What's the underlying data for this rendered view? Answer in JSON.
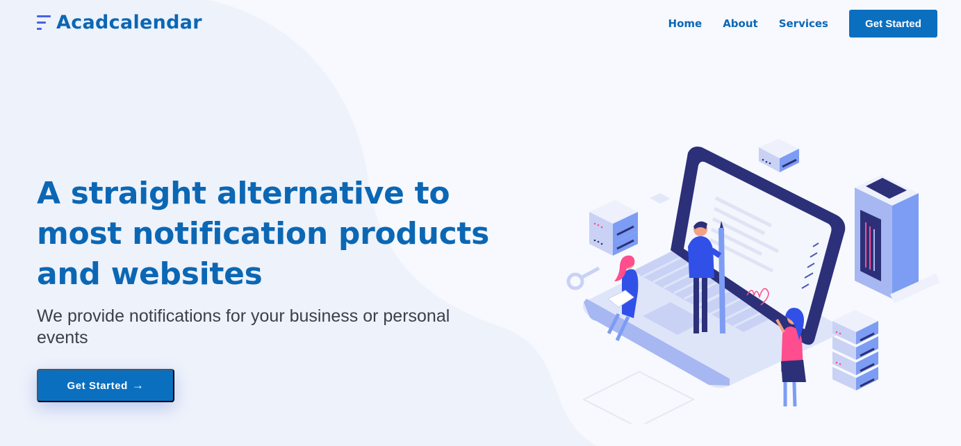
{
  "brand": {
    "name": "Acadcalendar"
  },
  "nav": {
    "items": [
      "Home",
      "About",
      "Services"
    ],
    "cta_label": "Get Started"
  },
  "hero": {
    "title": "A straight alternative to most notification products and websites",
    "subtitle": "We provide notifications for your business or personal events",
    "button_label": "Get Started",
    "button_icon": "arrow-right-icon"
  },
  "colors": {
    "primary": "#0b6fc0",
    "heading": "#0b67b4",
    "background": "#f2f5fd",
    "illustration_accent": "#ff4d8d",
    "illustration_dark": "#2c3079"
  }
}
